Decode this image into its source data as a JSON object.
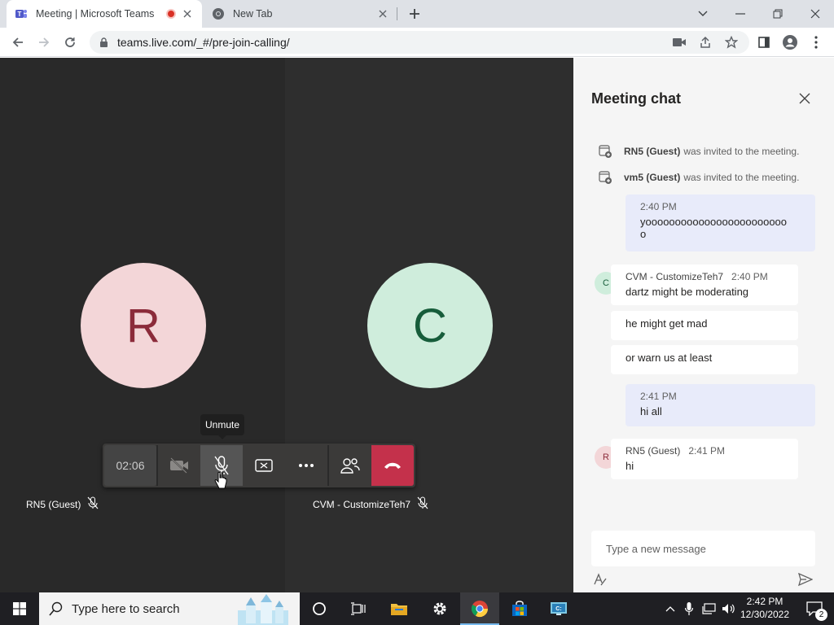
{
  "browser": {
    "tabs": [
      {
        "title": "Meeting | Microsoft Teams",
        "active": true
      },
      {
        "title": "New Tab",
        "active": false
      }
    ],
    "url": "teams.live.com/_#/pre-join-calling/"
  },
  "meeting": {
    "participants": [
      {
        "initial": "R",
        "name": "RN5 (Guest)"
      },
      {
        "initial": "C",
        "name": "CVM - CustomizeTeh7"
      }
    ],
    "timer": "02:06",
    "tooltip": "Unmute"
  },
  "chat": {
    "title": "Meeting chat",
    "system_messages": [
      {
        "name": "RN5 (Guest)",
        "text": "was invited to the meeting."
      },
      {
        "name": "vm5 (Guest)",
        "text": "was invited to the meeting."
      }
    ],
    "messages": [
      {
        "time": "2:40 PM",
        "lines": [
          "yoooooooooooooooooooooooo",
          "o"
        ]
      },
      {
        "initial": "C",
        "author": "CVM - CustomizeTeh7",
        "time": "2:40 PM",
        "text": "dartz might be moderating"
      },
      {
        "text": "he might get mad"
      },
      {
        "text": "or warn us at least"
      },
      {
        "time": "2:41 PM",
        "text": "hi all"
      },
      {
        "initial": "R",
        "author": "RN5 (Guest)",
        "time": "2:41 PM",
        "text": "hi"
      }
    ],
    "compose_placeholder": "Type a new message"
  },
  "taskbar": {
    "search_placeholder": "Type here to search",
    "time": "2:42 PM",
    "date": "12/30/2022",
    "notification_count": "2"
  },
  "colors": {
    "stage": "#292929",
    "avatar_r_bg": "#f3d6d8",
    "avatar_c_bg": "#cfeddc",
    "hangup": "#c4314b",
    "my_bubble": "#e8ebfa"
  }
}
